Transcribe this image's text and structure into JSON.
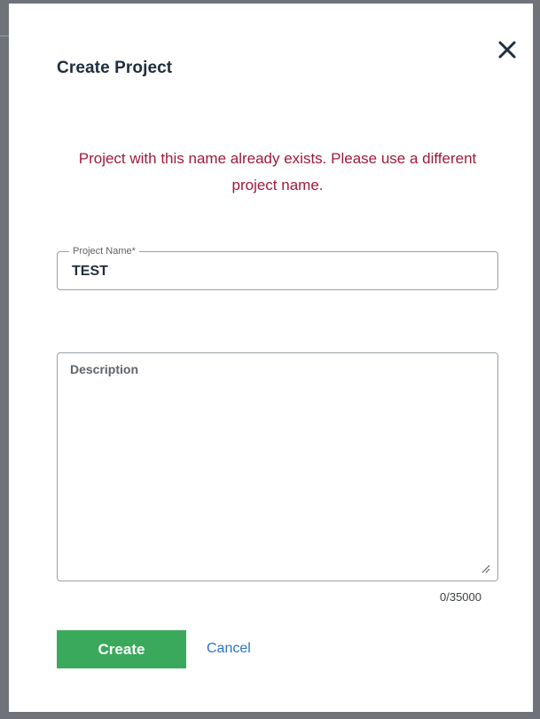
{
  "dialog": {
    "title": "Create Project",
    "close_icon": "close-icon",
    "error_message": "Project with this name already exists. Please use a different project name.",
    "project_name": {
      "label": "Project Name*",
      "value": "TEST"
    },
    "description": {
      "placeholder": "Description",
      "value": "",
      "char_count": "0/35000"
    },
    "buttons": {
      "create_label": "Create",
      "cancel_label": "Cancel"
    }
  },
  "colors": {
    "error": "#a11a3c",
    "primary_button": "#3aa95b",
    "link": "#2b73c7",
    "title": "#1f2d3d"
  }
}
